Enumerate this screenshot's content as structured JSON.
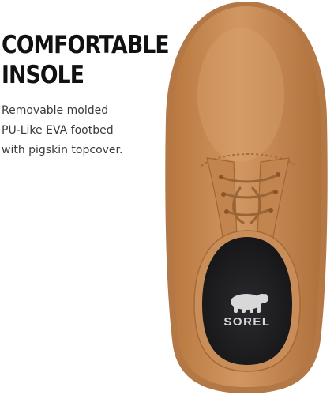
{
  "headline": {
    "line1": "COMFORTABLE",
    "line2": "INSOLE"
  },
  "description": {
    "line1": "Removable molded",
    "line2": "PU-Like EVA footbed",
    "line3": "with pigskin topcover."
  },
  "product_image": {
    "icon": "polar-bear-logo",
    "brand": "SOREL",
    "colors": {
      "suede": "#c78a55",
      "sole": "#b67a48",
      "insole": "#1d1d1f",
      "background": "#ffffff"
    }
  }
}
